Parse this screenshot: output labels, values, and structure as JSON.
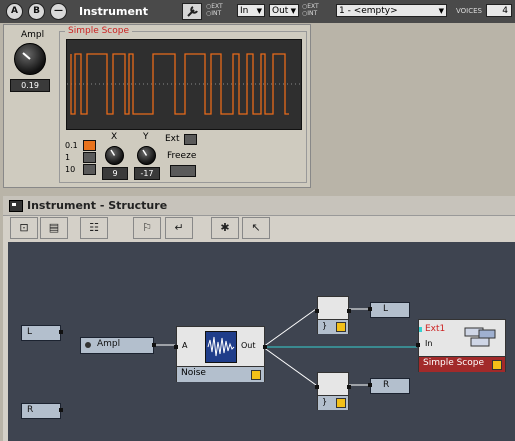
{
  "topbar": {
    "btn_a": "A",
    "btn_b": "B",
    "btn_minus": "—",
    "title": "Instrument",
    "ext_label": "EXT",
    "int_label": "INT",
    "in_select": "In",
    "out_select": "Out",
    "snapshot_select": "1 - <empty>",
    "voices_label": "VOICES",
    "voices_value": "4"
  },
  "panel": {
    "ampl_label": "Ampl",
    "ampl_value": "0.19",
    "scope_title": "Simple Scope",
    "range_options": [
      "0.1",
      "1",
      "10"
    ],
    "x_label": "X",
    "x_value": "9",
    "y_label": "Y",
    "y_value": "-17",
    "ext_label": "Ext",
    "freeze_label": "Freeze"
  },
  "structure": {
    "title": "Instrument - Structure",
    "modules": {
      "in_l": "L",
      "in_r": "R",
      "ampl": "Ampl",
      "noise_name": "Noise",
      "noise_in": "A",
      "noise_out": "Out",
      "out_l": "L",
      "out_r": "R",
      "scope_ext": "Ext1",
      "scope_in": "In",
      "scope_name": "Simple Scope",
      "bracket_top": "}",
      "bracket_bottom": "}"
    }
  },
  "colors": {
    "scope_trace": "#e86a1a",
    "scope_bg": "#2f2f2f",
    "accent_red": "#cc2222",
    "canvas_bg": "#3e4450",
    "port_blue": "#b3bfcd",
    "yellow": "#f3c018"
  }
}
